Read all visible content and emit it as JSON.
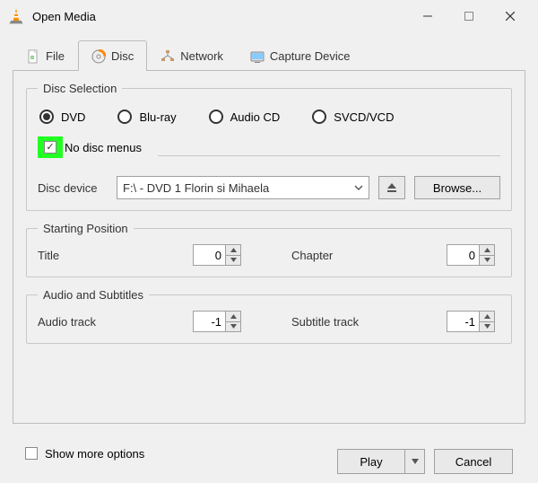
{
  "window": {
    "title": "Open Media"
  },
  "tabs": {
    "file": "File",
    "disc": "Disc",
    "network": "Network",
    "capture": "Capture Device",
    "active": "disc"
  },
  "discSelection": {
    "legend": "Disc Selection",
    "options": {
      "dvd": "DVD",
      "bluray": "Blu-ray",
      "audiocd": "Audio CD",
      "svcd": "SVCD/VCD"
    },
    "selected": "dvd",
    "noMenus": {
      "label": "No disc menus",
      "checked": true
    },
    "deviceLabel": "Disc device",
    "deviceValue": "F:\\ - DVD 1 Florin si Mihaela",
    "browse": "Browse..."
  },
  "startingPosition": {
    "legend": "Starting Position",
    "titleLabel": "Title",
    "titleValue": "0",
    "chapterLabel": "Chapter",
    "chapterValue": "0"
  },
  "audioSubs": {
    "legend": "Audio and Subtitles",
    "audioLabel": "Audio track",
    "audioValue": "-1",
    "subLabel": "Subtitle track",
    "subValue": "-1"
  },
  "footer": {
    "showMore": "Show more options",
    "play": "Play",
    "cancel": "Cancel"
  }
}
